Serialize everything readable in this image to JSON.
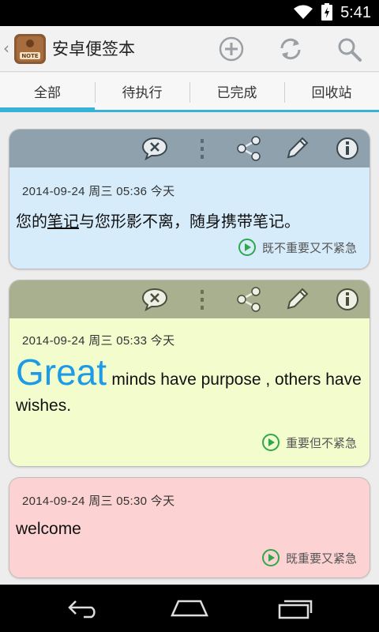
{
  "status_bar": {
    "time": "5:41",
    "icons": [
      "wifi-icon",
      "battery-icon"
    ]
  },
  "action_bar": {
    "app_title": "安卓便签本",
    "logo_text": "NOTE",
    "icons": [
      "add-icon",
      "sync-icon",
      "search-icon"
    ]
  },
  "tabs": [
    {
      "label": "全部",
      "active": true
    },
    {
      "label": "待执行",
      "active": false
    },
    {
      "label": "已完成",
      "active": false
    },
    {
      "label": "回收站",
      "active": false
    }
  ],
  "notes": [
    {
      "toolbar_color": "#8fa1ad",
      "body_color": "#d6ecfb",
      "toolbar_icons": [
        "delete-icon",
        "more-icon",
        "share-icon",
        "edit-icon",
        "info-icon"
      ],
      "datetime": "2014-09-24 周三 05:36 今天",
      "text_parts": [
        "您的",
        "笔记",
        "与您形影不离，随身携带笔记。"
      ],
      "priority": "既不重要又不紧急"
    },
    {
      "toolbar_color": "#a8b08f",
      "body_color": "#f2fccd",
      "toolbar_icons": [
        "delete-icon",
        "more-icon",
        "share-icon",
        "edit-icon",
        "info-icon"
      ],
      "datetime": "2014-09-24 周三 05:33 今天",
      "text_big": "Great",
      "text_rest": "minds have purpose , others have wishes.",
      "priority": "重要但不紧急"
    },
    {
      "body_color": "#fdd2d2",
      "datetime": "2014-09-24 周三 05:30 今天",
      "text": "welcome",
      "priority": "既重要又紧急"
    }
  ],
  "nav_bar": {
    "buttons": [
      "back-icon",
      "home-icon",
      "recents-icon"
    ]
  }
}
